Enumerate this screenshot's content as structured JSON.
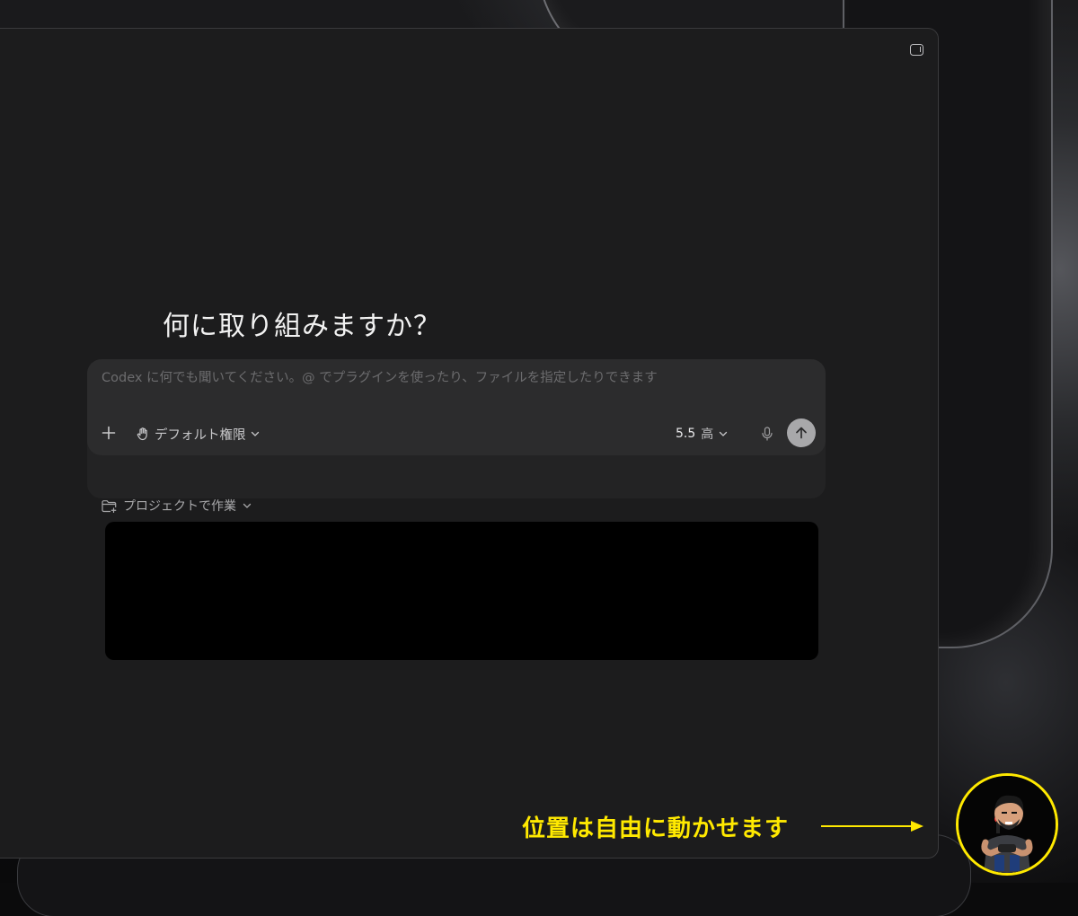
{
  "window": {
    "headline": "何に取り組みますか？",
    "sidebar_toggle_icon": "sidebar-toggle-icon"
  },
  "composer": {
    "placeholder": "Codex に何でも聞いてください。@ でプラグインを使ったり、ファイルを指定したりできます",
    "value": "",
    "add_icon": "plus-icon",
    "permission": {
      "icon": "hand-icon",
      "label": "デフォルト権限"
    },
    "model": {
      "version": "5.5",
      "level": "高"
    },
    "mic_icon": "microphone-icon",
    "send_icon": "arrow-up-icon"
  },
  "project": {
    "icon": "folder-icon",
    "label": "プロジェクトで作業"
  },
  "annotation": {
    "text": "位置は自由に動かせます",
    "color": "#ffe900"
  },
  "colors": {
    "window_bg": "#1c1c1d",
    "composer_bg": "#2c2c2d",
    "accent_yellow": "#ffe900",
    "send_button": "#a8a8aa"
  }
}
